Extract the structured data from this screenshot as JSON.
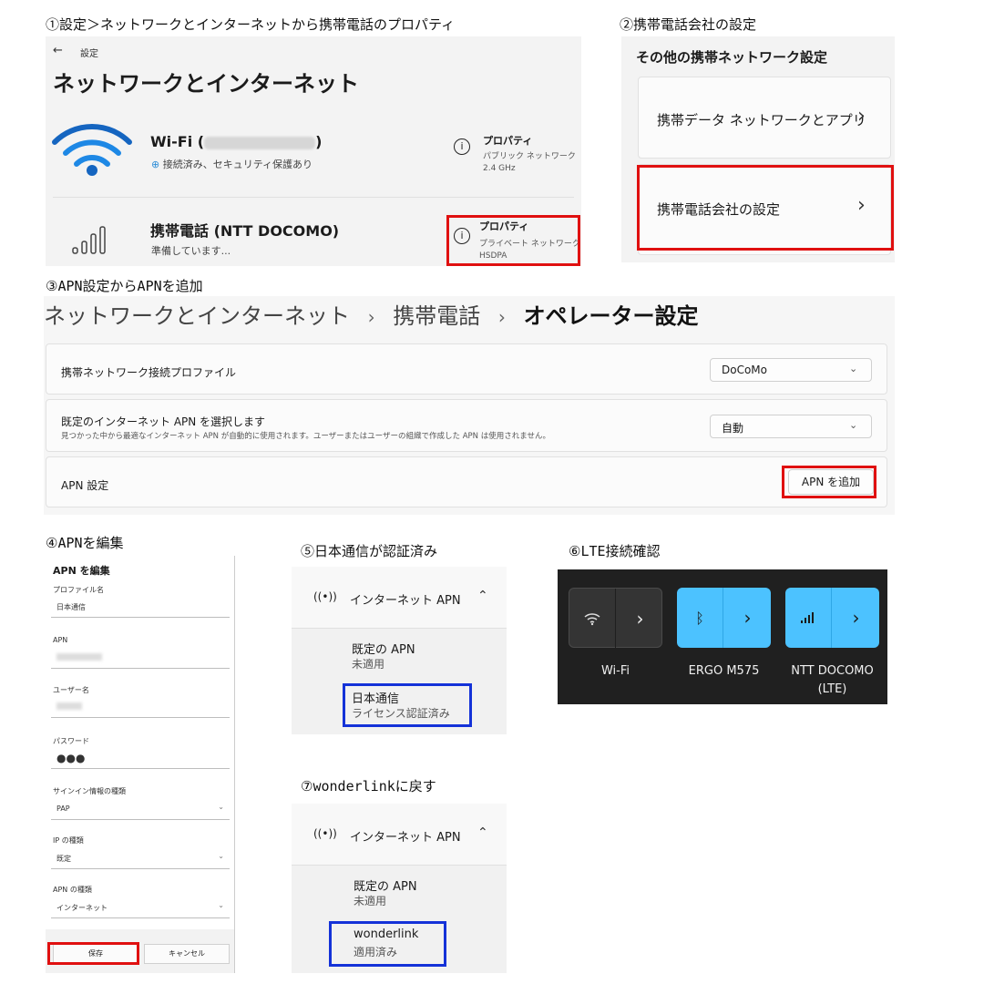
{
  "captions": {
    "c1": "①設定＞ネットワークとインターネットから携帯電話のプロパティ",
    "c2": "②携帯電話会社の設定",
    "c3": "③APN設定からAPNを追加",
    "c4": "④APNを編集",
    "c5": "⑤日本通信が認証済み",
    "c6": "⑥LTE接続確認",
    "c7": "⑦wonderlinkに戻す"
  },
  "p1": {
    "back_label": "設定",
    "title": "ネットワークとインターネット",
    "wifi": {
      "name": "Wi-Fi (",
      "name_end": ")",
      "status": "接続済み、セキュリティ保護あり",
      "prop_title": "プロパティ",
      "prop_line1": "パブリック ネットワーク",
      "prop_line2": "2.4 GHz"
    },
    "cell": {
      "name": "携帯電話 (NTT DOCOMO)",
      "status": "準備しています...",
      "prop_title": "プロパティ",
      "prop_line1": "プライベート ネットワーク",
      "prop_line2": "HSDPA"
    }
  },
  "p2": {
    "header": "その他の携帯ネットワーク設定",
    "item1": "携帯データ ネットワークとアプリ",
    "item2": "携帯電話会社の設定",
    "chevron": "›"
  },
  "p3": {
    "crumb1": "ネットワークとインターネット",
    "sep": "›",
    "crumb2": "携帯電話",
    "crumb3": "オペレーター設定",
    "row1_label": "携帯ネットワーク接続プロファイル",
    "row1_value": "DoCoMo",
    "row2_label": "既定のインターネット APN を選択します",
    "row2_desc": "見つかった中から最適なインターネット APN が自動的に使用されます。ユーザーまたはユーザーの組織で作成した APN は使用されません。",
    "row2_value": "自動",
    "row3_label": "APN 設定",
    "add_button": "APN を追加"
  },
  "p4": {
    "title": "APN を編集",
    "profile_label": "プロファイル名",
    "profile_value": "日本通信",
    "apn_label": "APN",
    "user_label": "ユーザー名",
    "password_label": "パスワード",
    "password_value": "●●●",
    "signin_label": "サインイン情報の種類",
    "signin_value": "PAP",
    "ip_label": "IP の種類",
    "ip_value": "既定",
    "apn_type_label": "APN の種類",
    "apn_type_value": "インターネット",
    "save": "保存",
    "cancel": "キャンセル"
  },
  "p5": {
    "header": "インターネット APN",
    "default_title": "既定の APN",
    "default_status": "未適用",
    "item_title": "日本通信",
    "item_status": "ライセンス認証済み"
  },
  "p6": {
    "wifi_label": "Wi-Fi",
    "bt_label": "ERGO M575",
    "cell_label_line1": "NTT DOCOMO",
    "cell_label_line2": "(LTE)",
    "accent": "#4cc2ff"
  },
  "p7": {
    "header": "インターネット APN",
    "default_title": "既定の APN",
    "default_status": "未適用",
    "item_title": "wonderlink",
    "item_status": "適用済み"
  }
}
